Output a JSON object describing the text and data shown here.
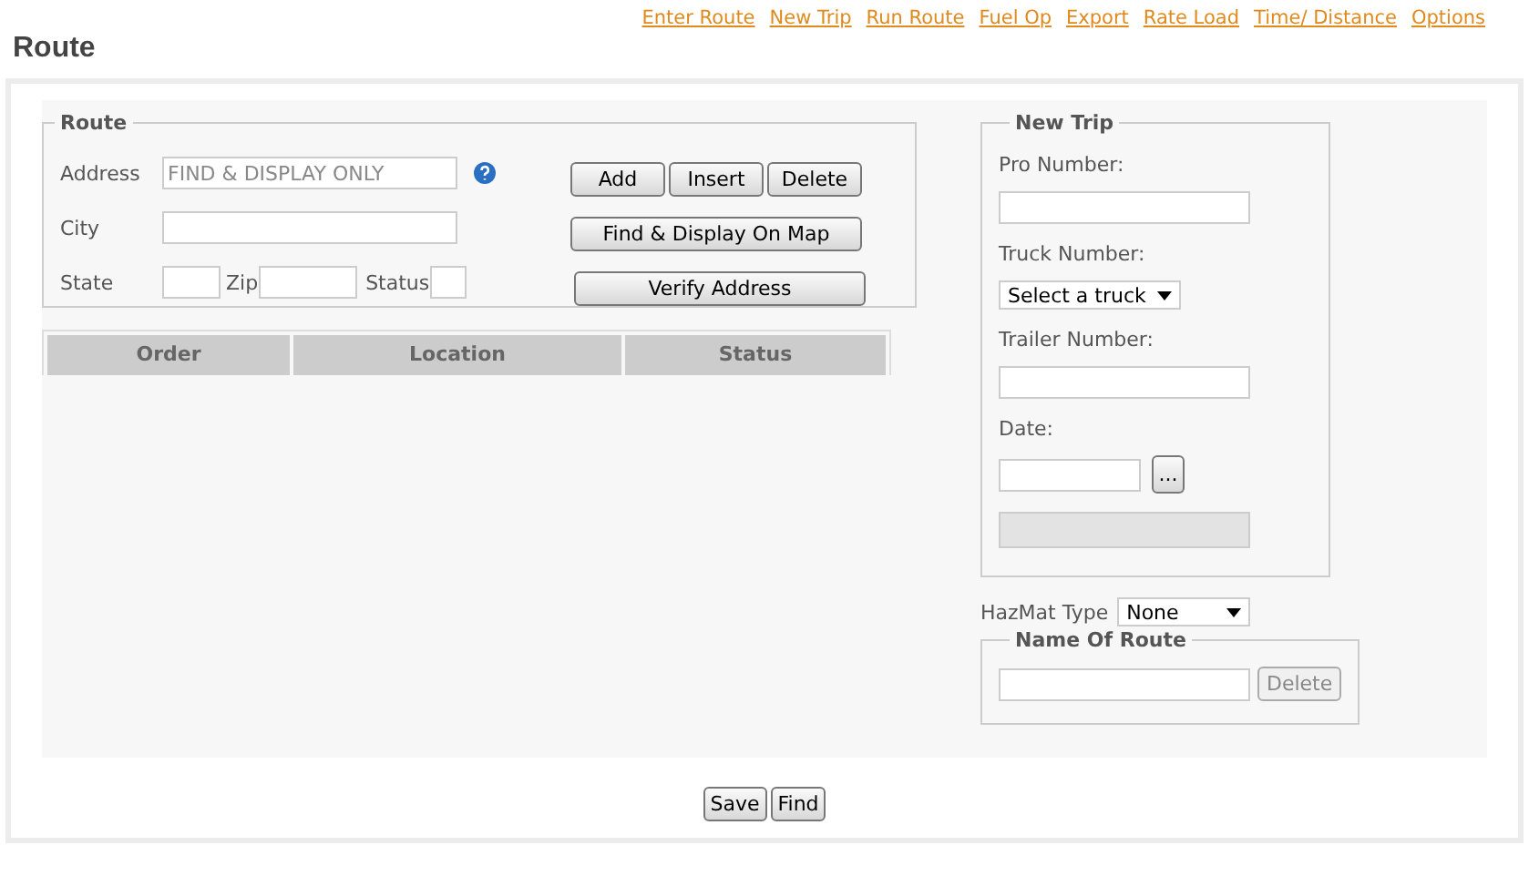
{
  "nav_links": [
    "Enter Route",
    "New Trip",
    "Run Route",
    "Fuel Op",
    "Export",
    "Rate Load",
    "Time/ Distance",
    "Options"
  ],
  "page_title": "Route",
  "route_panel": {
    "legend": "Route",
    "address_label": "Address",
    "address_value": "FIND & DISPLAY ONLY",
    "city_label": "City",
    "state_label": "State",
    "zip_label": "Zip",
    "status_label": "Status",
    "buttons": [
      "Add",
      "Insert",
      "Delete"
    ],
    "find_button": "Find & Display On Map",
    "verify_button": "Verify Address"
  },
  "table": {
    "columns": [
      "Order",
      "Location",
      "Status"
    ]
  },
  "new_trip": {
    "legend": "New Trip",
    "pro_label": "Pro Number:",
    "truck_label": "Truck Number:",
    "truck_select": "Select a truck",
    "trailer_label": "Trailer Number:",
    "date_label": "Date:",
    "date_button": "..."
  },
  "hazmat": {
    "label": "HazMat Type",
    "value": "None"
  },
  "name_of_route": {
    "legend": "Name Of Route",
    "button": {
      "label": "Delete",
      "disabled": true
    }
  },
  "footer_buttons": [
    "Save",
    "Find"
  ]
}
